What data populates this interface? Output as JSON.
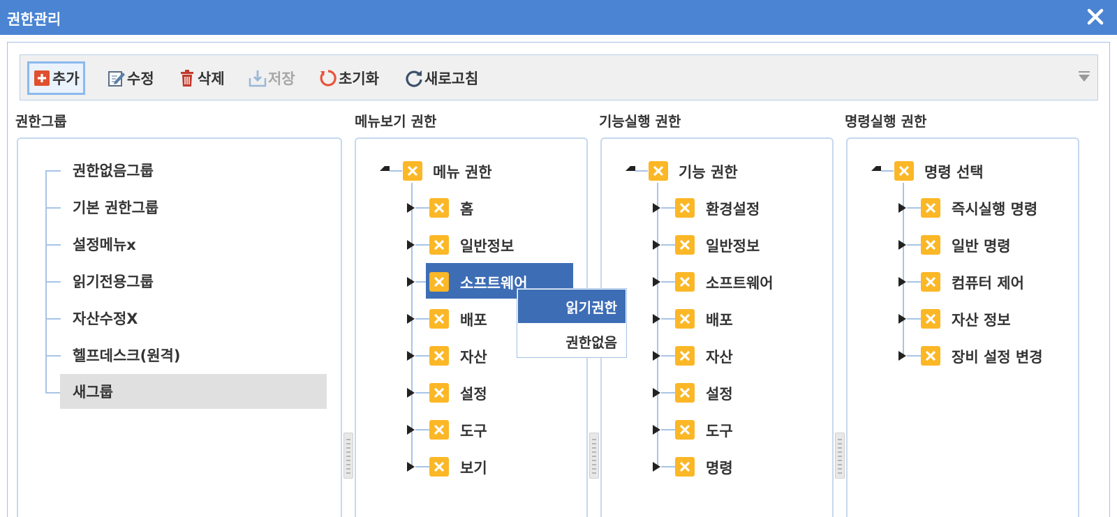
{
  "window": {
    "title": "권한관리"
  },
  "toolbar": {
    "add": "추가",
    "edit": "수정",
    "delete": "삭제",
    "save": "저장",
    "reset": "초기화",
    "refresh": "새로고침"
  },
  "sections": {
    "groups": "권한그룹",
    "menu": "메뉴보기 권한",
    "function": "기능실행 권한",
    "command": "명령실행 권한"
  },
  "groups": {
    "items": [
      "권한없음그룹",
      "기본 권한그룹",
      "설정메뉴x",
      "읽기전용그룹",
      "자산수정X",
      "헬프데스크(원격)",
      "새그룹"
    ],
    "selected": "새그룹"
  },
  "menu_tree": {
    "root": "메뉴 권한",
    "items": [
      "홈",
      "일반정보",
      "소프트웨어",
      "배포",
      "자산",
      "설정",
      "도구",
      "보기"
    ],
    "highlighted": "소프트웨어"
  },
  "function_tree": {
    "root": "기능 권한",
    "items": [
      "환경설정",
      "일반정보",
      "소프트웨어",
      "배포",
      "자산",
      "설정",
      "도구",
      "명령"
    ]
  },
  "command_tree": {
    "root": "명령 선택",
    "items": [
      "즉시실행 명령",
      "일반 명령",
      "컴퓨터 제어",
      "자산 정보",
      "장비 설정 변경"
    ]
  },
  "context_menu": {
    "items": [
      "읽기권한",
      "권한없음"
    ],
    "selected": "읽기권한"
  },
  "colors": {
    "titlebar": "#4a84d3",
    "checkbox": "#fbb726",
    "highlight": "#3d6db5",
    "selected_group": "#e0e0e0"
  },
  "icons": {
    "close": "close-icon",
    "add": "plus-square-icon",
    "edit": "edit-icon",
    "delete": "trash-icon",
    "save": "save-icon",
    "reset": "reset-icon",
    "refresh": "refresh-icon",
    "checkbox": "x-checkbox-icon"
  }
}
